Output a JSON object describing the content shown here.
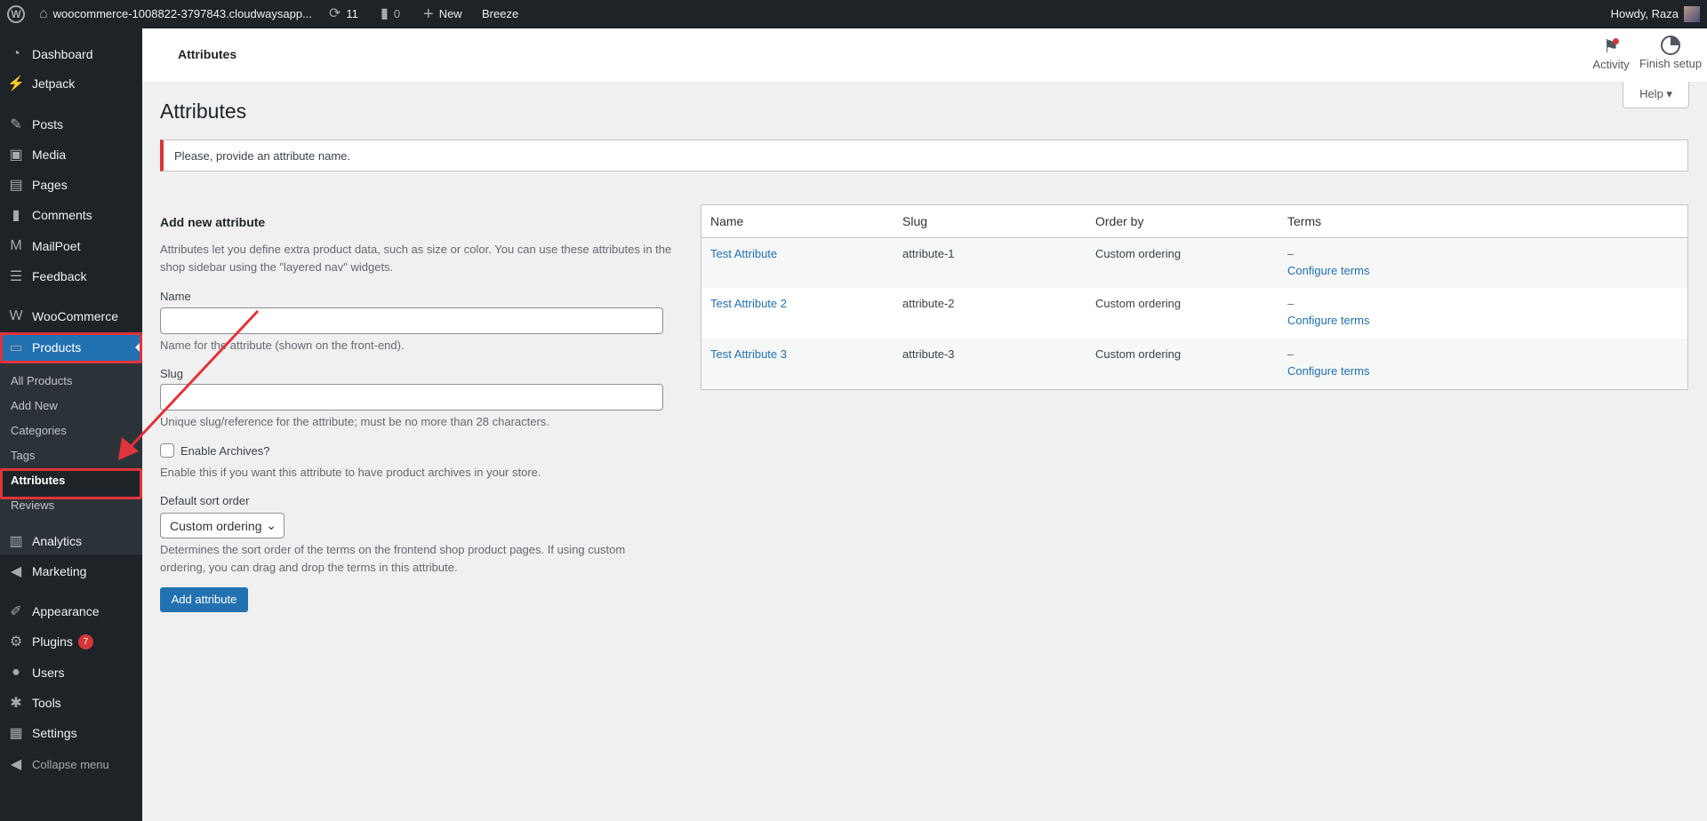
{
  "adminbar": {
    "site": "woocommerce-1008822-3797843.cloudwaysapp...",
    "updates": "11",
    "comments": "0",
    "new": "New",
    "breeze": "Breeze",
    "howdy": "Howdy, Raza"
  },
  "sidebar": {
    "items": [
      {
        "label": "Dashboard",
        "icon": "dashboard-icon"
      },
      {
        "label": "Jetpack",
        "icon": "jetpack-icon"
      },
      {
        "label": "Posts",
        "icon": "pin-icon"
      },
      {
        "label": "Media",
        "icon": "media-icon"
      },
      {
        "label": "Pages",
        "icon": "pages-icon"
      },
      {
        "label": "Comments",
        "icon": "comment-icon"
      },
      {
        "label": "MailPoet",
        "icon": "mailpoet-icon"
      },
      {
        "label": "Feedback",
        "icon": "feedback-icon"
      },
      {
        "label": "WooCommerce",
        "icon": "woo-icon"
      },
      {
        "label": "Products",
        "icon": "archive-icon"
      },
      {
        "label": "Analytics",
        "icon": "chart-icon"
      },
      {
        "label": "Marketing",
        "icon": "megaphone-icon"
      },
      {
        "label": "Appearance",
        "icon": "brush-icon"
      },
      {
        "label": "Plugins",
        "icon": "plugin-icon",
        "badge": "7"
      },
      {
        "label": "Users",
        "icon": "user-icon"
      },
      {
        "label": "Tools",
        "icon": "wrench-icon"
      },
      {
        "label": "Settings",
        "icon": "settings-icon"
      },
      {
        "label": "Collapse menu",
        "icon": "collapse-icon"
      }
    ],
    "submenu": [
      "All Products",
      "Add New",
      "Categories",
      "Tags",
      "Attributes",
      "Reviews"
    ]
  },
  "header": {
    "title": "Attributes",
    "activity": "Activity",
    "finish_setup": "Finish setup",
    "help": "Help ▾"
  },
  "page": {
    "title": "Attributes",
    "notice": "Please, provide an attribute name."
  },
  "form": {
    "heading": "Add new attribute",
    "desc1": "Attributes let you define extra product data, such as size or color. You can use these attributes in the",
    "desc2": "shop sidebar using the \"layered nav\" widgets.",
    "name_label": "Name",
    "name_value": "",
    "name_help": "Name for the attribute (shown on the front-end).",
    "slug_label": "Slug",
    "slug_value": "",
    "slug_help": "Unique slug/reference for the attribute; must be no more than 28 characters.",
    "archives_label": "Enable Archives?",
    "archives_help": "Enable this if you want this attribute to have product archives in your store.",
    "sort_label": "Default sort order",
    "sort_value": "Custom ordering",
    "sort_help1": "Determines the sort order of the terms on the frontend shop product pages. If using custom",
    "sort_help2": "ordering, you can drag and drop the terms in this attribute.",
    "submit": "Add attribute"
  },
  "table": {
    "headers": [
      "Name",
      "Slug",
      "Order by",
      "Terms"
    ],
    "rows": [
      {
        "name": "Test Attribute",
        "slug": "attribute-1",
        "order": "Custom ordering",
        "terms": "–",
        "link": "Configure terms"
      },
      {
        "name": "Test Attribute 2",
        "slug": "attribute-2",
        "order": "Custom ordering",
        "terms": "–",
        "link": "Configure terms"
      },
      {
        "name": "Test Attribute 3",
        "slug": "attribute-3",
        "order": "Custom ordering",
        "terms": "–",
        "link": "Configure terms"
      }
    ]
  },
  "colors": {
    "accent": "#2271b1",
    "highlight": "#e0343a",
    "sidebar": "#1d2327"
  }
}
